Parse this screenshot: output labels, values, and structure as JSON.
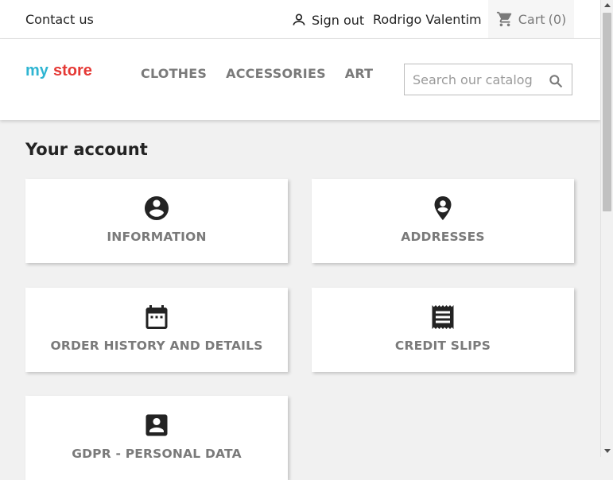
{
  "topbar": {
    "contact_label": "Contact us",
    "signout_label": "Sign out",
    "user_name": "Rodrigo Valentim",
    "cart_label": "Cart",
    "cart_count": "(0)"
  },
  "header": {
    "logo_text_1": "my",
    "logo_text_2": "store",
    "nav": [
      "CLOTHES",
      "ACCESSORIES",
      "ART"
    ],
    "search_placeholder": "Search our catalog"
  },
  "page": {
    "title": "Your account",
    "cards": [
      {
        "label": "INFORMATION",
        "icon": "account-circle-icon"
      },
      {
        "label": "ADDRESSES",
        "icon": "location-pin-icon"
      },
      {
        "label": "ORDER HISTORY AND DETAILS",
        "icon": "calendar-icon"
      },
      {
        "label": "CREDIT SLIPS",
        "icon": "receipt-icon"
      },
      {
        "label": "GDPR - PERSONAL DATA",
        "icon": "account-box-icon"
      }
    ]
  },
  "colors": {
    "accent_logo_blue": "#2fb5d2",
    "accent_logo_red": "#e53935",
    "text_dark": "#232323",
    "text_muted": "#7a7a7a",
    "background": "#f1f1f1"
  }
}
